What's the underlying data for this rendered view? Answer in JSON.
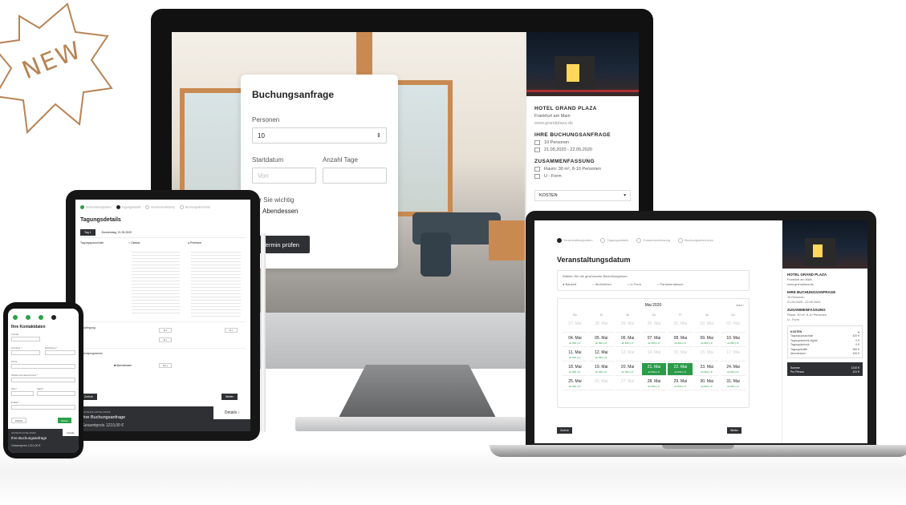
{
  "badge": {
    "text": "NEW",
    "color": "#b98353"
  },
  "monitor": {
    "form": {
      "title": "Buchungsanfrage",
      "persons_label": "Personen",
      "persons_value": "10",
      "start_label": "Startdatum",
      "start_placeholder": "Von",
      "days_label": "Anzahl Tage",
      "days_placeholder": "",
      "important_label": "Für Sie wichtig",
      "option_dinner": "Abendessen",
      "submit_label": "Termin prüfen"
    },
    "sidebar": {
      "hotel_name": "HOTEL GRAND PLAZA",
      "hotel_city": "Frankfurt am Main",
      "hotel_url": "www.grandplaza.de",
      "request_heading": "IHRE BUCHUNGSANFRAGE",
      "persons": "10 Personen",
      "dates": "21.05.2020 - 22.05.2020",
      "summary_heading": "ZUSAMMENFASSUNG",
      "room": "Raum: 30 m², 8-10 Personen",
      "layout": "U - Form",
      "costs_label": "KOSTEN"
    }
  },
  "laptop": {
    "steps": [
      "Veranstaltungsdaten",
      "Tagungsdetails",
      "Zusammenfassung",
      "Buchungsabschluss"
    ],
    "title": "Veranstaltungsdatum",
    "options_hint": "Wählen Sie die gewünschte Bestuhlungsform:",
    "options": [
      "Bankett",
      "Stuhlreihen",
      "U-Form",
      "Parlamentarisch"
    ],
    "month": "Mai 2020",
    "next_label": "Juni",
    "weekdays": [
      "Mo",
      "Di",
      "Mi",
      "Do",
      "Fr",
      "Sa",
      "So"
    ],
    "rows": [
      [
        {
          "d": "27. Mai",
          "p": "",
          "s": "dis"
        },
        {
          "d": "28. Mai",
          "p": "",
          "s": "dis"
        },
        {
          "d": "29. Mai",
          "p": "",
          "s": "dis"
        },
        {
          "d": "30. Mai",
          "p": "",
          "s": "dis"
        },
        {
          "d": "01. Mai",
          "p": "",
          "s": "dis"
        },
        {
          "d": "02. Mai",
          "p": "",
          "s": "dis"
        },
        {
          "d": "03. Mai",
          "p": "",
          "s": "dis"
        }
      ],
      [
        {
          "d": "04. Mai",
          "p": "ab 890 p.P.",
          "s": ""
        },
        {
          "d": "05. Mai",
          "p": "ab 890 p.P.",
          "s": ""
        },
        {
          "d": "06. Mai",
          "p": "ab 890 p.P.",
          "s": ""
        },
        {
          "d": "07. Mai",
          "p": "ab 890 p.P.",
          "s": ""
        },
        {
          "d": "08. Mai",
          "p": "ab 890 p.P.",
          "s": ""
        },
        {
          "d": "09. Mai",
          "p": "ab 890 p.P.",
          "s": ""
        },
        {
          "d": "10. Mai",
          "p": "ab 890 p.P.",
          "s": ""
        }
      ],
      [
        {
          "d": "11. Mai",
          "p": "ab 890 p.P.",
          "s": ""
        },
        {
          "d": "12. Mai",
          "p": "ab 890 p.P.",
          "s": ""
        },
        {
          "d": "13. Mai",
          "p": "",
          "s": "dis"
        },
        {
          "d": "14. Mai",
          "p": "",
          "s": "dis"
        },
        {
          "d": "15. Mai",
          "p": "",
          "s": "dis"
        },
        {
          "d": "16. Mai",
          "p": "",
          "s": "dis"
        },
        {
          "d": "17. Mai",
          "p": "",
          "s": "dis"
        }
      ],
      [
        {
          "d": "18. Mai",
          "p": "ab 890 p.P.",
          "s": ""
        },
        {
          "d": "19. Mai",
          "p": "ab 890 p.P.",
          "s": ""
        },
        {
          "d": "20. Mai",
          "p": "ab 890 p.P.",
          "s": ""
        },
        {
          "d": "21. Mai",
          "p": "ab 890 p.P.",
          "s": "sel"
        },
        {
          "d": "22. Mai",
          "p": "ab 890 p.P.",
          "s": "sel"
        },
        {
          "d": "23. Mai",
          "p": "ab 890 p.P.",
          "s": ""
        },
        {
          "d": "24. Mai",
          "p": "ab 890 p.P.",
          "s": ""
        }
      ],
      [
        {
          "d": "25. Mai",
          "p": "ab 890 p.P.",
          "s": ""
        },
        {
          "d": "26. Mai",
          "p": "",
          "s": "dis"
        },
        {
          "d": "27. Mai",
          "p": "",
          "s": "dis"
        },
        {
          "d": "28. Mai",
          "p": "ab 890 p.P.",
          "s": ""
        },
        {
          "d": "29. Mai",
          "p": "ab 890 p.P.",
          "s": ""
        },
        {
          "d": "30. Mai",
          "p": "ab 890 p.P.",
          "s": ""
        },
        {
          "d": "31. Mai",
          "p": "ab 890 p.P.",
          "s": ""
        }
      ]
    ],
    "back_label": "Zurück",
    "next_button": "Weiter",
    "sidebar": {
      "hotel_name": "HOTEL GRAND PLAZA",
      "hotel_city": "Frankfurt am Main",
      "hotel_url": "www.grandplaza.de",
      "request_heading": "IHRE BUCHUNGSANFRAGE",
      "persons": "10 Personen",
      "dates": "21.05.2020 - 22.05.2020",
      "summary_heading": "ZUSAMMENFASSUNG",
      "room": "Raum: 30 m², 8-10 Personen",
      "layout": "U - Form",
      "costs_label": "KOSTEN",
      "costs": [
        {
          "k": "Tagungspauschale",
          "v": "420 €"
        },
        {
          "k": "Tagungstechnik digital",
          "v": "0 €"
        },
        {
          "k": "Tagungstechnik",
          "v": "0 €"
        },
        {
          "k": "Tagungsbuffet",
          "v": "360 €"
        },
        {
          "k": "Abendessen",
          "v": "430 €"
        }
      ],
      "sum_label": "Summe",
      "sum_value": "1210 €",
      "per_person_label": "Pro Person",
      "per_person_value": "121 €"
    }
  },
  "tablet": {
    "steps": [
      "Veranstaltungsdaten",
      "Tagungsdetails",
      "Zusammenfassung",
      "Buchungsabschluss"
    ],
    "title": "Tagungsdetails",
    "tab_active": "Tag 1",
    "tab_other": "Donnerstag, 21.05.2020",
    "section_1": "Tagungspauschale",
    "section_2": "Verpflegung",
    "section_3": "Abendprogramme",
    "option_classic": "Classic",
    "option_premium": "Premium",
    "option_dinner": "Abendessen",
    "back_label": "Zurück",
    "next_label": "Weiter",
    "foot_hotel": "HAUSHOF HOTEL MAINZ",
    "foot_title": "Ihre Buchungsanfrage",
    "foot_total": "Gesamtpreis    1210,00 €",
    "details_label": "Details  ›"
  },
  "phone": {
    "title": "Ihre Kontaktdaten",
    "fields": [
      "Anrede",
      "Vorname *",
      "Nachname *",
      "Firma",
      "Straße und Hausnummer *",
      "PLZ *",
      "Stadt *",
      "E-Mail *"
    ],
    "back_label": "Zurück",
    "next_label": "Weiter",
    "foot_hotel": "HAUSHOF HOTEL MAINZ",
    "foot_title": "Ihre Buchungsanfrage",
    "foot_total": "Gesamtpreis    1210,00 €",
    "details_label": "Details"
  }
}
